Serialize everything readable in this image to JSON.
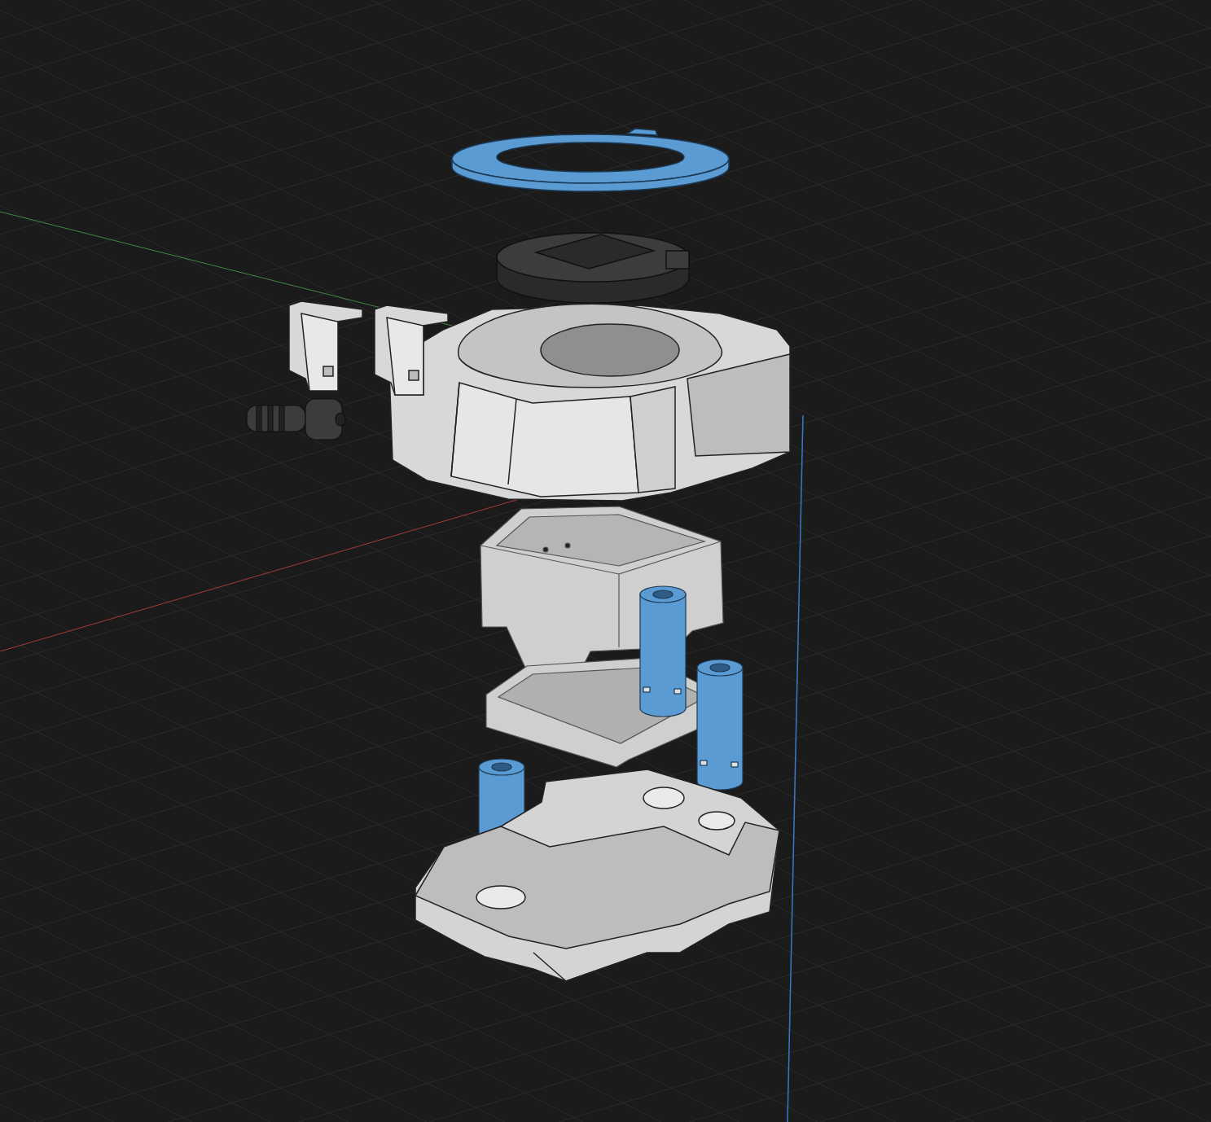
{
  "viewport": {
    "parts": [
      {
        "kind": "ring",
        "color": "#5a9bd3"
      },
      {
        "kind": "cap",
        "color": "#3c3c3c"
      },
      {
        "kind": "housing",
        "color": "#d8d8d8"
      },
      {
        "kind": "clip",
        "color": "#d8d8d8"
      },
      {
        "kind": "clip",
        "color": "#d8d8d8"
      },
      {
        "kind": "screw",
        "color": "#3c3c3c"
      },
      {
        "kind": "box",
        "color": "#cfcfcf"
      },
      {
        "kind": "tray",
        "color": "#cfcfcf"
      },
      {
        "kind": "pin",
        "color": "#5a9bd3"
      },
      {
        "kind": "pin",
        "color": "#5a9bd3"
      },
      {
        "kind": "pin",
        "color": "#5a9bd3"
      },
      {
        "kind": "base",
        "color": "#d4d4d4"
      }
    ]
  }
}
